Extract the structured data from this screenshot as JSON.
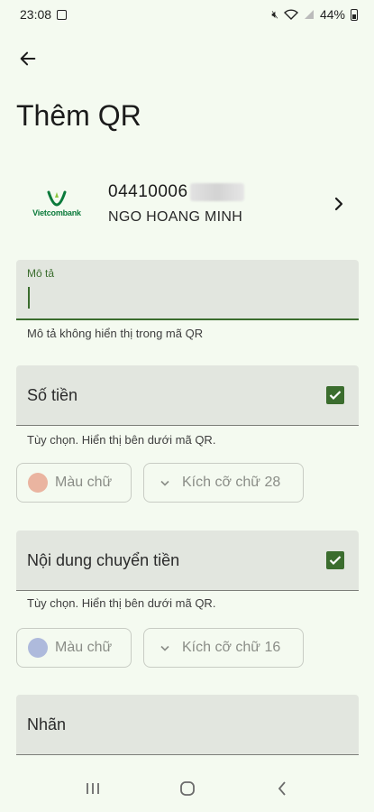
{
  "status_bar": {
    "time": "23:08",
    "battery": "44%"
  },
  "page": {
    "title": "Thêm QR"
  },
  "account": {
    "bank_name": "Vietcombank",
    "number": "04410006",
    "holder": "NGO HOANG MINH"
  },
  "description_field": {
    "label": "Mô tả",
    "value": "",
    "helper": "Mô tả không hiển thị trong mã QR"
  },
  "amount_section": {
    "label": "Số tiền",
    "checked": true,
    "helper": "Tùy chọn. Hiển thị bên dưới mã QR.",
    "color_chip": {
      "label": "Màu chữ",
      "color": "#eab4a0"
    },
    "size_chip": {
      "label": "Kích cỡ chữ 28"
    }
  },
  "content_section": {
    "label": "Nội dung chuyển tiền",
    "checked": true,
    "helper": "Tùy chọn. Hiển thị bên dưới mã QR.",
    "color_chip": {
      "label": "Màu chữ",
      "color": "#aebadc"
    },
    "size_chip": {
      "label": "Kích cỡ chữ 16"
    }
  },
  "label_section": {
    "label": "Nhãn"
  },
  "colors": {
    "accent": "#3b6d2e",
    "background": "#f4faf0",
    "field_bg": "#e2e6df",
    "brand_green": "#0b7a3b"
  },
  "icons": {
    "back": "arrow-left-icon",
    "chevron_right": "chevron-right-icon",
    "check": "check-icon",
    "chevron_down": "chevron-down-icon",
    "nav_recent": "recent-apps-icon",
    "nav_home": "home-icon",
    "nav_back": "nav-back-icon"
  }
}
